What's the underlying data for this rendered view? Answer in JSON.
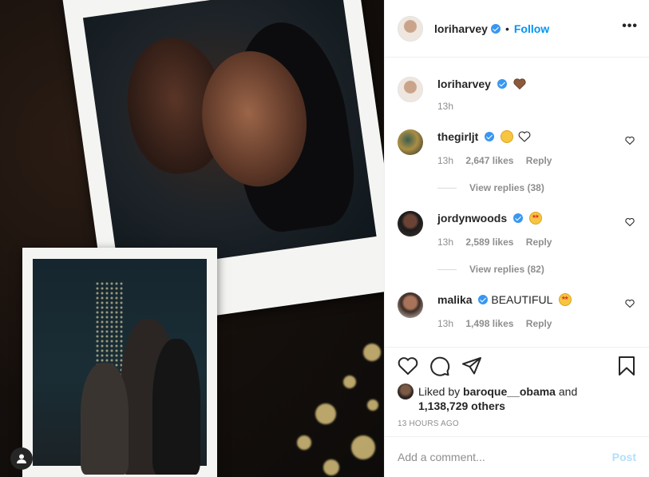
{
  "post": {
    "author": "loriharvey",
    "follow_label": "Follow",
    "more_label": "•••",
    "caption_time": "13h"
  },
  "comments": [
    {
      "user": "thegirljt",
      "text": "",
      "emojis": [
        "disappointed-face",
        "white-heart"
      ],
      "time": "13h",
      "likes": "2,647 likes",
      "reply": "Reply",
      "view_replies": "View replies (38)"
    },
    {
      "user": "jordynwoods",
      "text": "",
      "emojis": [
        "star-struck"
      ],
      "time": "13h",
      "likes": "2,589 likes",
      "reply": "Reply",
      "view_replies": "View replies (82)"
    },
    {
      "user": "malika",
      "text": "BEAUTIFUL",
      "emojis": [
        "star-struck"
      ],
      "time": "13h",
      "likes": "1,498 likes",
      "reply": "Reply"
    }
  ],
  "likes": {
    "prefix": "Liked by",
    "liker": "baroque__obama",
    "conj": "and",
    "others": "1,138,729 others"
  },
  "time_ago": "13 HOURS AGO",
  "add_comment": {
    "placeholder": "Add a comment...",
    "post_label": "Post"
  },
  "colors": {
    "accent": "#0095f6",
    "verified": "#3897f0",
    "muted": "#8e8e8e",
    "post_disabled": "#b2dffc"
  }
}
